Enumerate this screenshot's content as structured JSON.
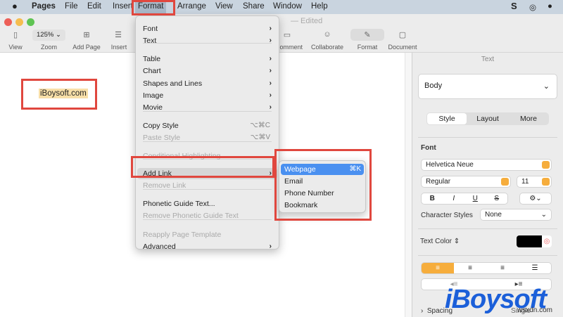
{
  "menubar": {
    "apple": "",
    "items": [
      "Pages",
      "File",
      "Edit",
      "Insert",
      "Format",
      "Arrange",
      "View",
      "Share",
      "Window",
      "Help"
    ],
    "status_icons": [
      "s-icon",
      "search-chat-icon",
      "notification-icon"
    ]
  },
  "window": {
    "title_suffix": "— Edited"
  },
  "toolbar": {
    "view": "View",
    "zoom_value": "125%",
    "zoom": "Zoom",
    "add_page": "Add Page",
    "insert": "Insert",
    "comment": "Comment",
    "collaborate": "Collaborate",
    "format": "Format",
    "document": "Document"
  },
  "document": {
    "text": "iBoysoft.com"
  },
  "format_menu": {
    "items": [
      {
        "label": "Font",
        "arrow": true
      },
      {
        "label": "Text",
        "arrow": true
      },
      {
        "label": "Table",
        "arrow": true
      },
      {
        "label": "Chart",
        "arrow": true
      },
      {
        "label": "Shapes and Lines",
        "arrow": true
      },
      {
        "label": "Image",
        "arrow": true
      },
      {
        "label": "Movie",
        "arrow": true
      },
      {
        "label": "Copy Style",
        "shortcut": "⌥⌘C"
      },
      {
        "label": "Paste Style",
        "shortcut": "⌥⌘V",
        "disabled": true
      },
      {
        "label": "Conditional Highlighting...",
        "disabled": true
      },
      {
        "label": "Add Link",
        "arrow": true,
        "highlighted": true
      },
      {
        "label": "Remove Link",
        "disabled": true
      },
      {
        "label": "Phonetic Guide Text..."
      },
      {
        "label": "Remove Phonetic Guide Text",
        "disabled": true
      },
      {
        "label": "Reapply Page Template",
        "disabled": true
      },
      {
        "label": "Advanced",
        "arrow": true
      }
    ]
  },
  "link_submenu": {
    "items": [
      {
        "label": "Webpage",
        "shortcut": "⌘K",
        "highlighted": true
      },
      {
        "label": "Email"
      },
      {
        "label": "Phone Number"
      },
      {
        "label": "Bookmark"
      }
    ]
  },
  "sidebar": {
    "header": "Text",
    "paragraph_style": "Body",
    "tabs": [
      "Style",
      "Layout",
      "More"
    ],
    "font_label": "Font",
    "font_family": "Helvetica Neue",
    "font_weight": "Regular",
    "font_size": "11",
    "style_buttons": [
      "B",
      "I",
      "U",
      "S"
    ],
    "char_styles_label": "Character Styles",
    "char_styles_value": "None",
    "text_color_label": "Text Color ⇕",
    "text_color": "#000000",
    "spacing_label": "Spacing",
    "spacing_value": "Single"
  },
  "watermark": {
    "logo": "iBoysoft",
    "site": "wsxdn.com"
  },
  "colors": {
    "accent": "#f6ad3c",
    "highlight": "#4a90f0",
    "callout": "#e0473e"
  }
}
